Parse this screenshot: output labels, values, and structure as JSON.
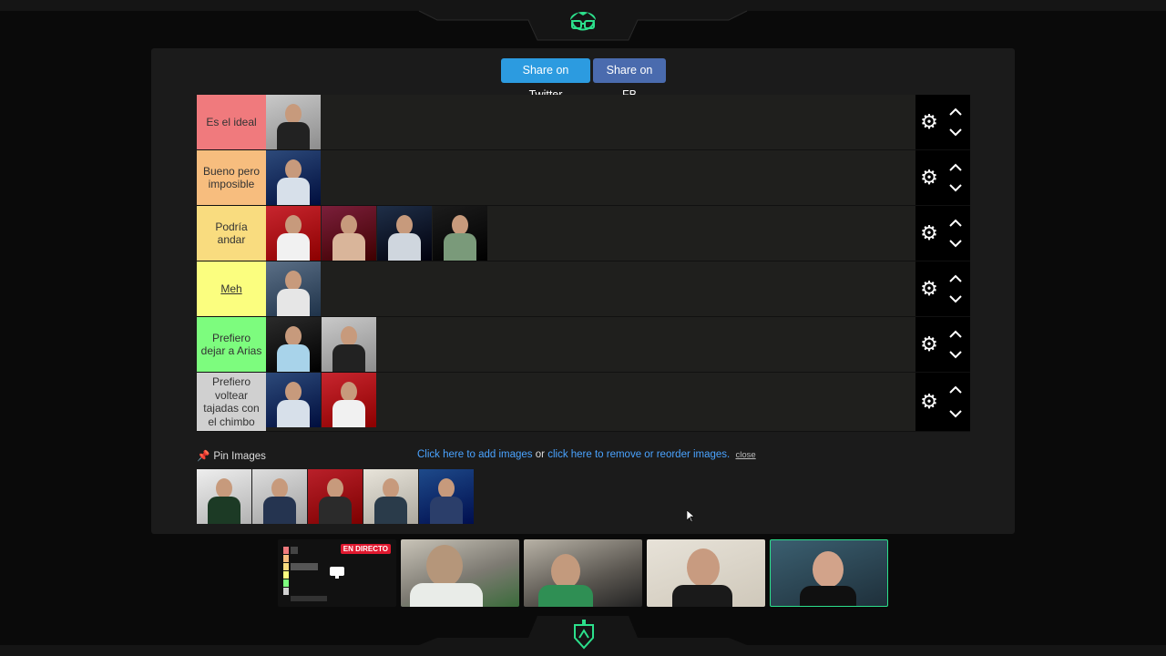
{
  "share": {
    "twitter_label": "Share on Twitter",
    "facebook_label": "Share on FB"
  },
  "tiers": [
    {
      "label": "Es el ideal",
      "color": "#f07a7d",
      "underline": false,
      "items": 1
    },
    {
      "label": "Bueno pero imposible",
      "color": "#f7bd7e",
      "underline": false,
      "items": 1
    },
    {
      "label": "Podría andar",
      "color": "#f9dc7f",
      "underline": false,
      "items": 4
    },
    {
      "label": "Meh",
      "color": "#fbfe7f",
      "underline": true,
      "items": 1
    },
    {
      "label": "Prefiero dejar a Arias",
      "color": "#7dfc7e",
      "underline": false,
      "items": 2
    },
    {
      "label": "Prefiero voltear tajadas con el chimbo",
      "color": "#d0d0d0",
      "underline": false,
      "items": 2
    }
  ],
  "pin": {
    "label": "Pin Images",
    "icon": "pin-icon"
  },
  "links": {
    "add": "Click here to add images",
    "or": "or",
    "remove": "click here to remove or reorder images.",
    "close": "close"
  },
  "pool_count": 5,
  "stream": {
    "live_badge": "EN DIRECTO"
  },
  "colors": {
    "accent": "#2ce08c",
    "panel": "#1b1b1b",
    "link": "#4aa3ff"
  }
}
